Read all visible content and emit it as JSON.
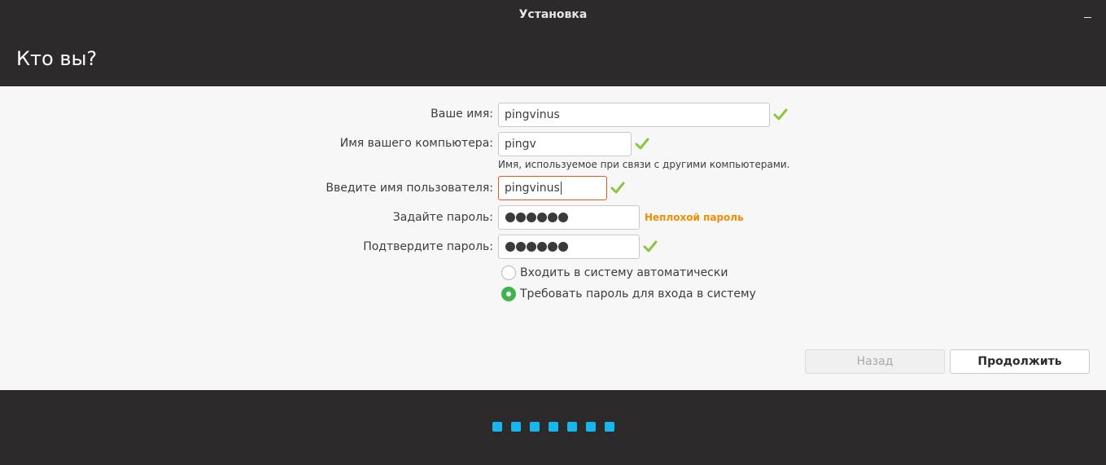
{
  "window": {
    "title": "Установка",
    "minimize_label": "_"
  },
  "header": {
    "title": "Кто вы?"
  },
  "form": {
    "name": {
      "label": "Ваше имя:",
      "value": "pingvinus"
    },
    "computer": {
      "label": "Имя вашего компьютера:",
      "value": "pingv",
      "hint": "Имя, используемое при связи с другими компьютерами."
    },
    "username": {
      "label": "Введите имя пользователя:",
      "value": "pingvinus"
    },
    "password": {
      "label": "Задайте пароль:",
      "masked_chars": 6,
      "strength": "Неплохой пароль"
    },
    "confirm": {
      "label": "Подтвердите пароль:",
      "masked_chars": 6
    },
    "login_options": [
      {
        "label": "Входить в систему автоматически",
        "selected": false
      },
      {
        "label": "Требовать пароль для входа в систему",
        "selected": true
      }
    ]
  },
  "buttons": {
    "back": "Назад",
    "continue": "Продолжить"
  },
  "progress": {
    "total_steps": 7
  },
  "colors": {
    "accent_orange": "#e95420",
    "valid_check": "#8cc63f",
    "strength_text": "#f18e00",
    "radio_selected": "#3eb34f",
    "progress_dot": "#19b6ee"
  },
  "icons": {
    "valid": "check-icon",
    "minimize": "minimize-icon"
  }
}
